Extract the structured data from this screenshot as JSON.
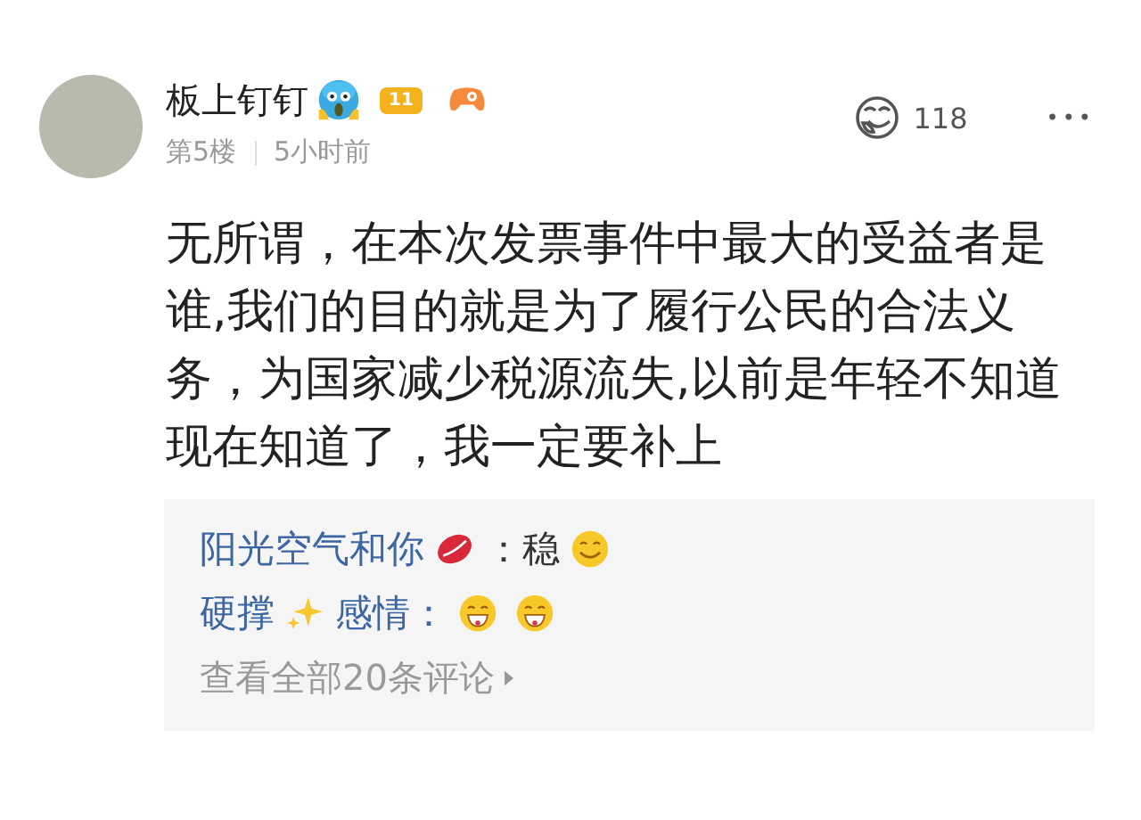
{
  "post": {
    "author": "板上钉钉",
    "level": "11",
    "floor": "第5楼",
    "time": "5小时前",
    "likes": "118",
    "more": "•••",
    "body": "无所谓，在本次发票事件中最大的受益者是谁,我们的目的就是为了履行公民的合法义务，为国家减少税源流失,以前是年轻不知道现在知道了，我一定要补上"
  },
  "replies": [
    {
      "segments": [
        {
          "kind": "name",
          "text": "阳光空气和你"
        },
        {
          "kind": "lips"
        },
        {
          "kind": "text",
          "text": "：稳"
        },
        {
          "kind": "smile"
        }
      ]
    },
    {
      "segments": [
        {
          "kind": "name",
          "text": "硬撑"
        },
        {
          "kind": "sparkle"
        },
        {
          "kind": "name",
          "text": "感情："
        },
        {
          "kind": "grin"
        },
        {
          "kind": "grin"
        }
      ]
    }
  ],
  "view_all": "查看全部20条评论"
}
